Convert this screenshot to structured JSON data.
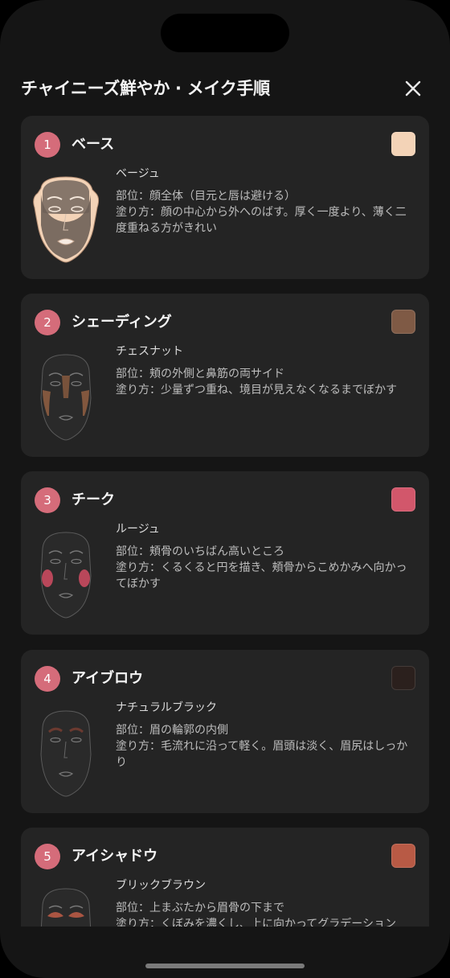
{
  "header": {
    "title": "チャイニーズ鮮やか · メイク手順"
  },
  "steps": [
    {
      "num": "1",
      "title": "ベース",
      "swatch_color": "#f3d3b7",
      "color_name": "ベージュ",
      "area": "部位：顔全体（目元と唇は避ける）",
      "method": "塗り方：顔の中心から外へのばす。厚く一度より、薄く二度重ねる方がきれい"
    },
    {
      "num": "2",
      "title": "シェーディング",
      "swatch_color": "#7f5a45",
      "color_name": "チェスナット",
      "area": "部位：頬の外側と鼻筋の両サイド",
      "method": "塗り方：少量ずつ重ね、境目が見えなくなるまでぼかす"
    },
    {
      "num": "3",
      "title": "チーク",
      "swatch_color": "#d2576b",
      "color_name": "ルージュ",
      "area": "部位：頬骨のいちばん高いところ",
      "method": "塗り方：くるくると円を描き、頬骨からこめかみへ向かってぼかす"
    },
    {
      "num": "4",
      "title": "アイブロウ",
      "swatch_color": "#2b201d",
      "color_name": "ナチュラルブラック",
      "area": "部位：眉の輪郭の内側",
      "method": "塗り方：毛流れに沿って軽く。眉頭は淡く、眉尻はしっかり"
    },
    {
      "num": "5",
      "title": "アイシャドウ",
      "swatch_color": "#b85a45",
      "color_name": "ブリックブラウン",
      "area": "部位：上まぶたから眉骨の下まで",
      "method": "塗り方：くぼみを濃くし、上に向かってグラデーション"
    }
  ]
}
